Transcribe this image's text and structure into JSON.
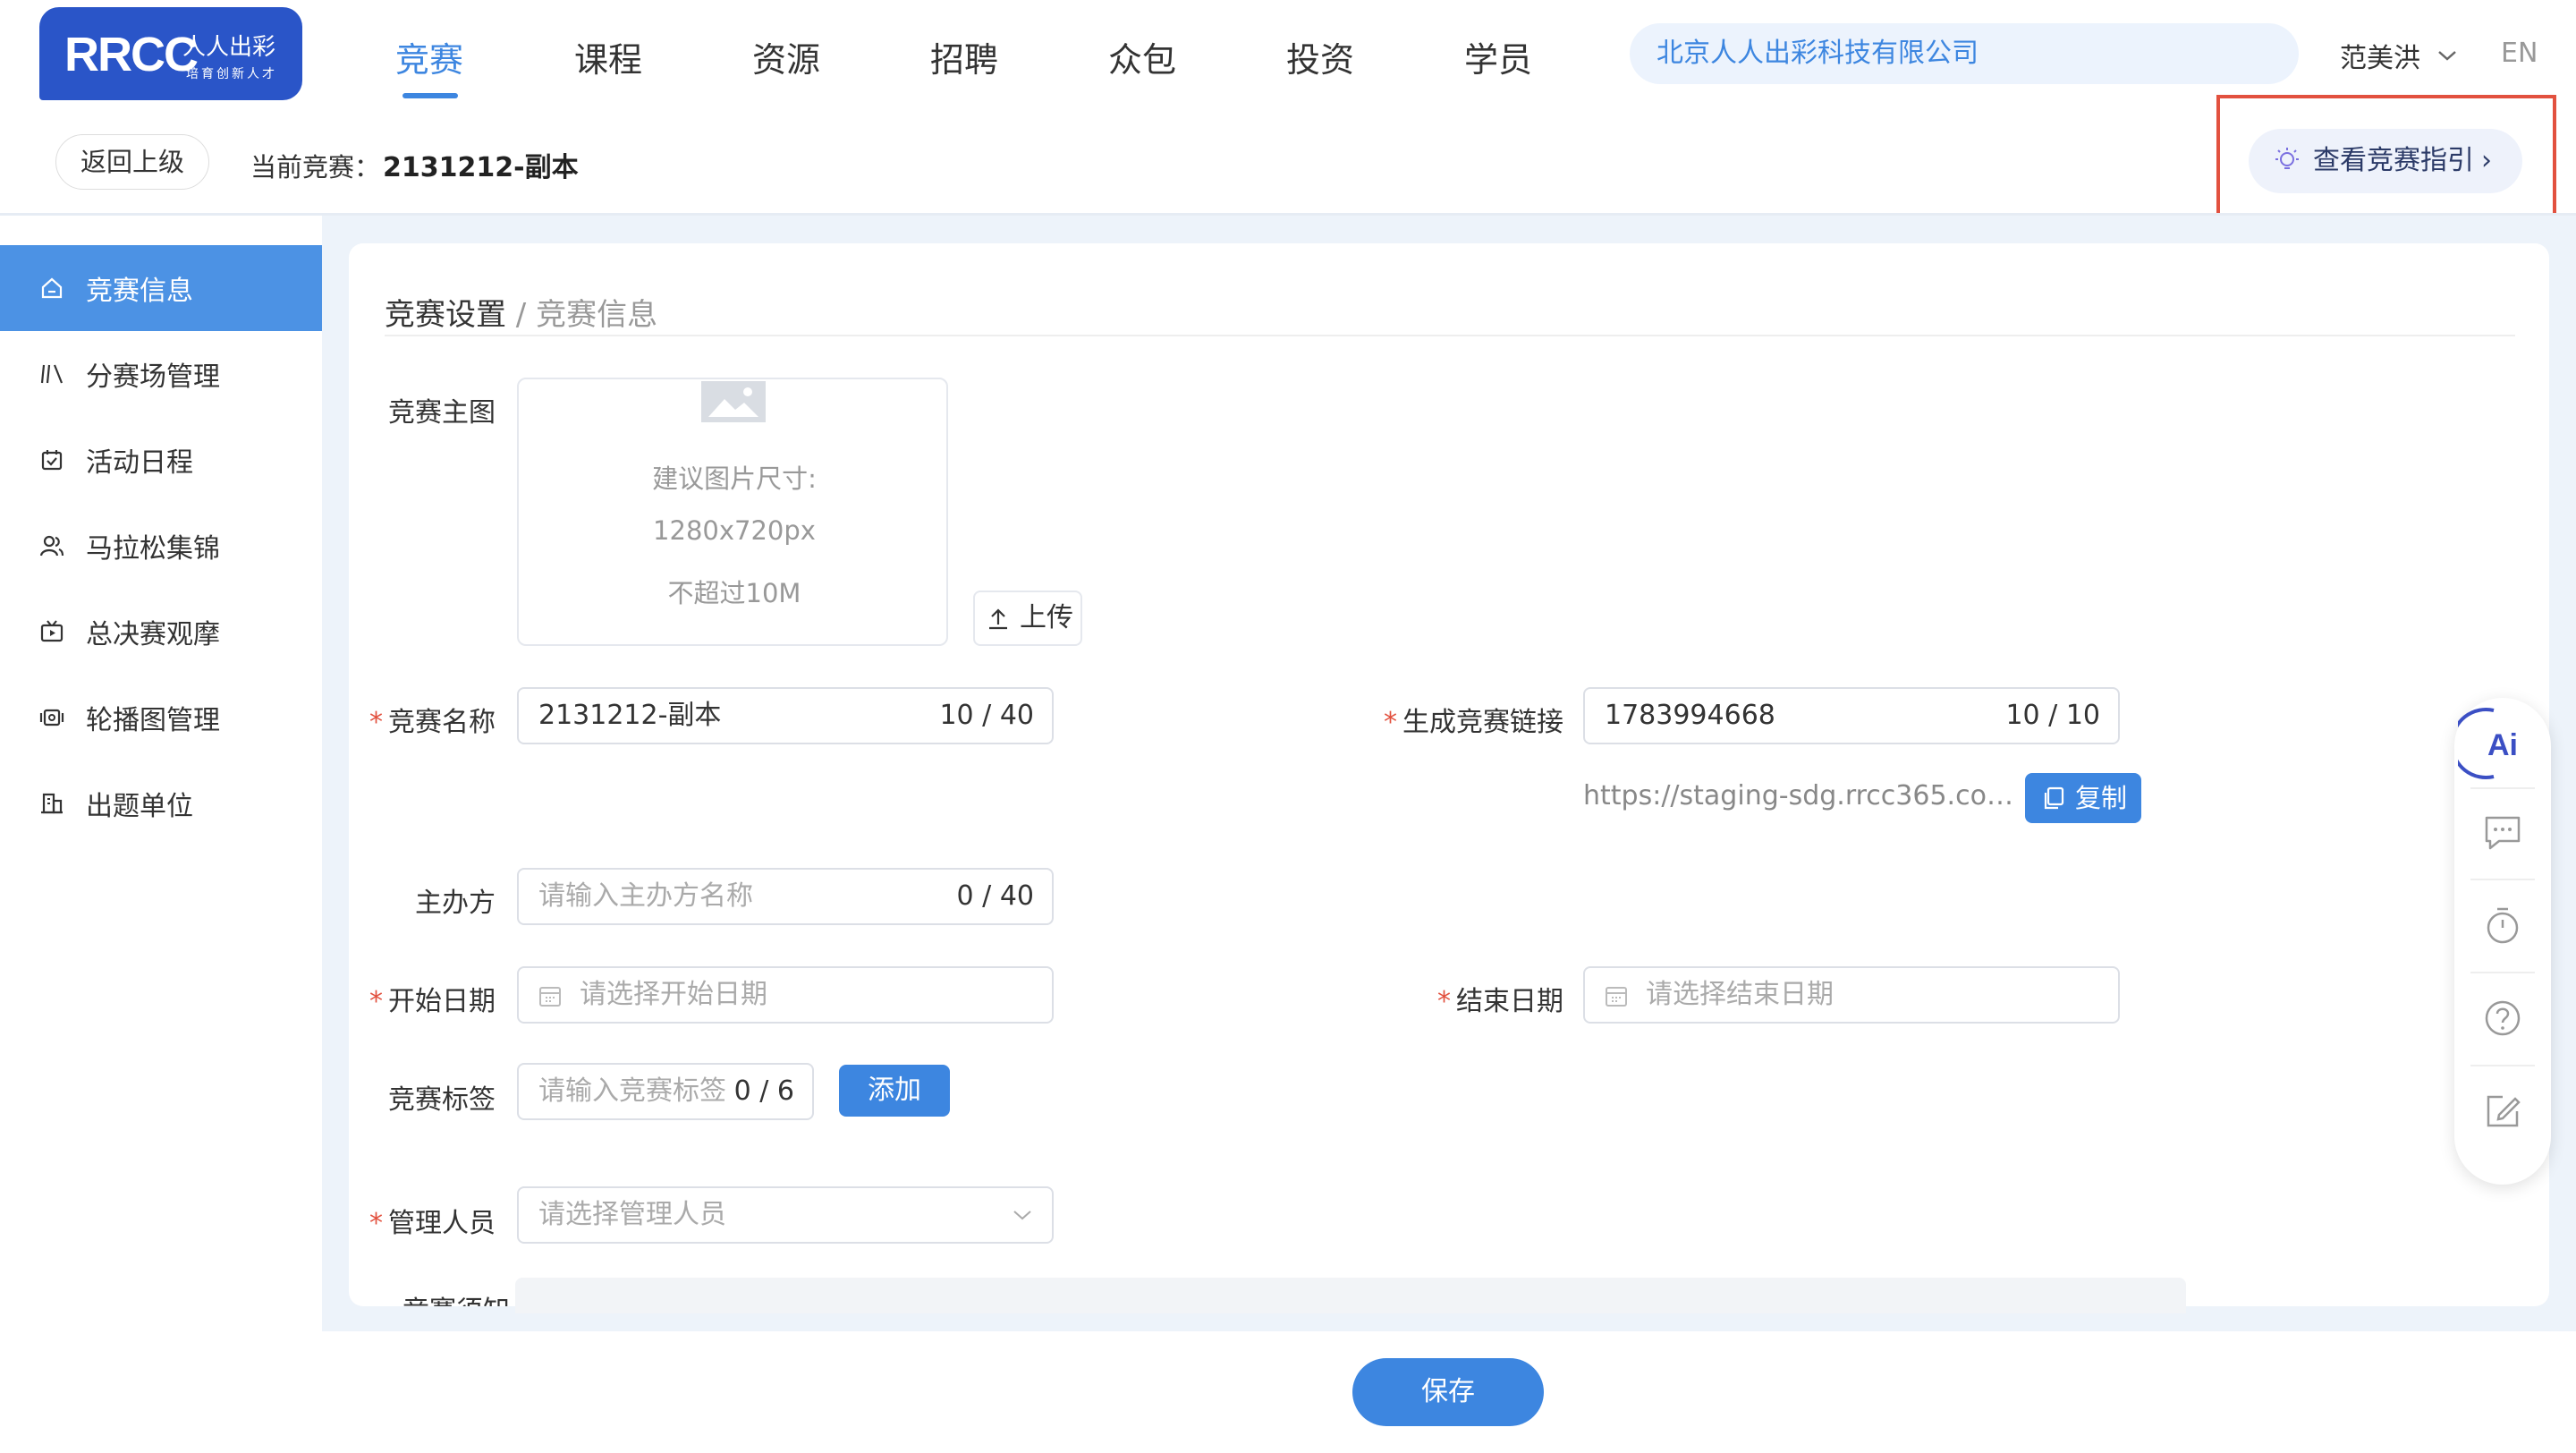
{
  "logo": {
    "brand": "RRCC",
    "cn_name": "人人出彩",
    "slogan": "培育创新人才"
  },
  "nav": {
    "items": [
      "竞赛",
      "课程",
      "资源",
      "招聘",
      "众包",
      "投资",
      "学员"
    ],
    "active": "竞赛"
  },
  "header": {
    "company": "北京人人出彩科技有限公司",
    "user_name": "范美洪",
    "lang": "EN"
  },
  "subheader": {
    "back_label": "返回上级",
    "current_label": "当前竞赛：",
    "current_name": "2131212-副本",
    "guide_label": "查看竞赛指引"
  },
  "sidebar": {
    "items": [
      {
        "label": "竞赛信息",
        "icon": "home-icon",
        "active": true
      },
      {
        "label": "分赛场管理",
        "icon": "books-icon"
      },
      {
        "label": "活动日程",
        "icon": "calendar-check-icon"
      },
      {
        "label": "马拉松集锦",
        "icon": "users-icon"
      },
      {
        "label": "总决赛观摩",
        "icon": "tv-icon"
      },
      {
        "label": "轮播图管理",
        "icon": "carousel-icon"
      },
      {
        "label": "出题单位",
        "icon": "building-icon"
      }
    ]
  },
  "breadcrumb": {
    "parent": "竞赛设置",
    "sep": " / ",
    "current": "竞赛信息"
  },
  "form": {
    "main_image": {
      "label": "竞赛主图",
      "hint1": "建议图片尺寸:",
      "hint2": "1280x720px",
      "hint3": "不超过10M",
      "upload_label": "上传"
    },
    "name": {
      "label": "竞赛名称",
      "value": "2131212-副本",
      "count": "10 / 40"
    },
    "link": {
      "label": "生成竞赛链接",
      "value": "1783994668",
      "count": "10 / 10",
      "url": "https://staging-sdg.rrcc365.co…",
      "copy_label": "复制"
    },
    "organizer": {
      "label": "主办方",
      "placeholder": "请输入主办方名称",
      "count": "0 / 40"
    },
    "start_date": {
      "label": "开始日期",
      "placeholder": "请选择开始日期"
    },
    "end_date": {
      "label": "结束日期",
      "placeholder": "请选择结束日期"
    },
    "tags": {
      "label": "竞赛标签",
      "placeholder": "请输入竞赛标签",
      "count": "0 / 6",
      "add_label": "添加"
    },
    "managers": {
      "label": "管理人员",
      "placeholder": "请选择管理人员"
    },
    "notice": {
      "label": "竞赛须知"
    }
  },
  "footer": {
    "save_label": "保存"
  },
  "float_tools": [
    "ai-icon",
    "chat-icon",
    "timer-icon",
    "help-icon",
    "edit-icon"
  ],
  "colors": {
    "primary": "#3d86e0",
    "brand": "#2a55c8",
    "highlight": "#e2513f",
    "required": "#e2513f"
  }
}
